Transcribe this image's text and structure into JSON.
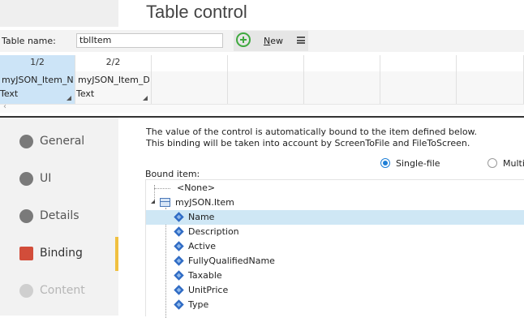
{
  "header": {
    "title": "Table control"
  },
  "table_name": {
    "label": "Table name:",
    "value": "tblItem"
  },
  "toolbar": {
    "new_label_underline": "N",
    "new_label_rest": "ew"
  },
  "columns": [
    {
      "header": "1/2",
      "name": "myJSON_Item_Na",
      "type": "Text"
    },
    {
      "header": "2/2",
      "name": "myJSON_Item_De",
      "type": "Text"
    }
  ],
  "sidebar": {
    "items": [
      {
        "label": "General",
        "icon": "general-icon"
      },
      {
        "label": "UI",
        "icon": "ui-icon"
      },
      {
        "label": "Details",
        "icon": "details-icon"
      },
      {
        "label": "Binding",
        "icon": "binding-icon"
      },
      {
        "label": "Content",
        "icon": "content-icon"
      }
    ]
  },
  "binding": {
    "description_line1": "The value of the control is automatically bound to the item defined below.",
    "description_line2": "This binding will be taken into account by ScreenToFile and FileToScreen.",
    "radio_single": "Single-file",
    "radio_multi": "Multi",
    "bound_label": "Bound item:",
    "tree": {
      "none": "<None>",
      "root": "myJSON.Item",
      "children": [
        "Name",
        "Description",
        "Active",
        "FullyQualifiedName",
        "Taxable",
        "UnitPrice",
        "Type"
      ]
    }
  }
}
